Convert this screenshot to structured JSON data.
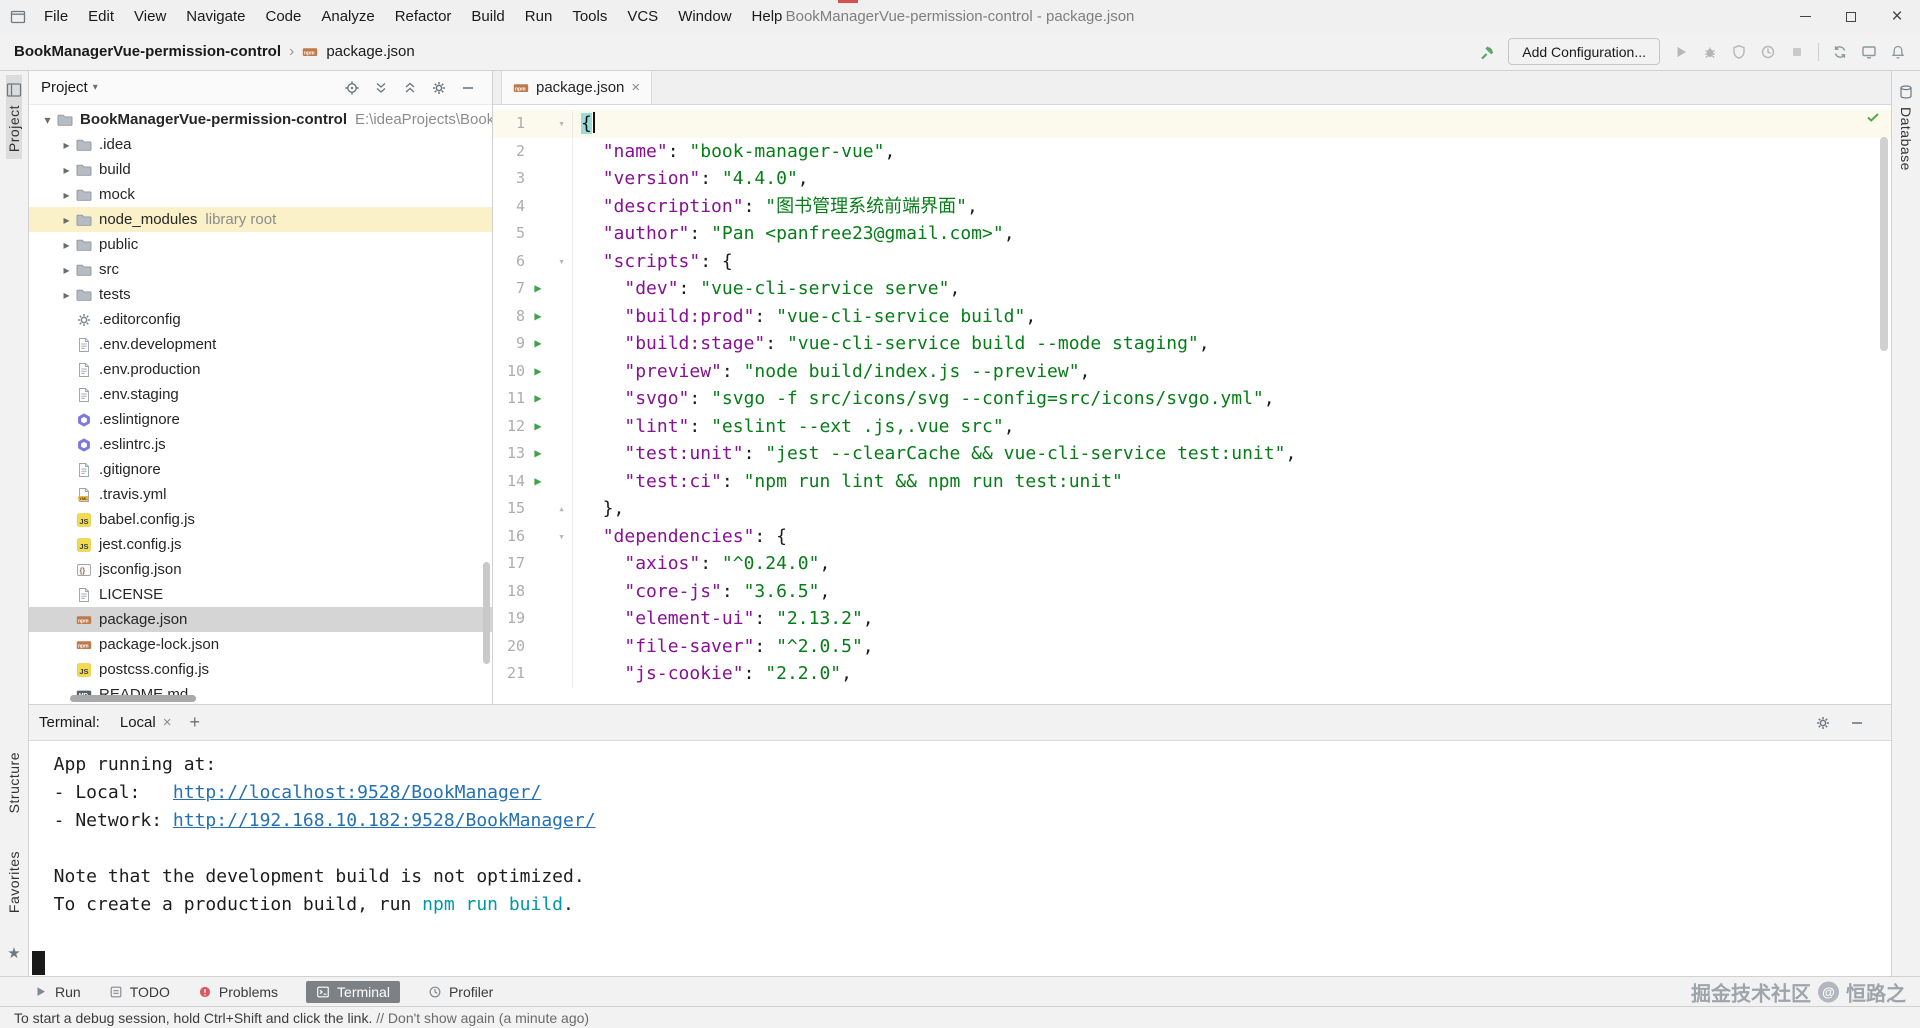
{
  "colors": {
    "accent_green": "#59A869",
    "json_key": "#871094",
    "json_string": "#067D17",
    "link_blue": "#2470B3",
    "terminal_cyan": "#0097A7",
    "problems_red": "#DB5860",
    "selection_gray": "#D5D5D5",
    "library_highlight": "#FAF1C8"
  },
  "window": {
    "title": "BookManagerVue-permission-control - package.json",
    "menu": [
      "File",
      "Edit",
      "View",
      "Navigate",
      "Code",
      "Analyze",
      "Refactor",
      "Build",
      "Run",
      "Tools",
      "VCS",
      "Window",
      "Help"
    ]
  },
  "navbar": {
    "breadcrumb_project": "BookManagerVue-permission-control",
    "breadcrumb_file": "package.json",
    "add_configuration": "Add Configuration...",
    "right_icons": [
      "run-icon",
      "debug-icon",
      "coverage-icon",
      "profiler-icon",
      "stop-icon",
      "divider",
      "sync-icon",
      "monitor-icon",
      "notifications-icon"
    ]
  },
  "stripes": {
    "project": "Project",
    "structure": "Structure",
    "favorites": "Favorites",
    "database": "Database"
  },
  "project_panel": {
    "title": "Project",
    "header_icons": [
      "locate-icon",
      "expand-all-icon",
      "collapse-all-icon",
      "settings-gear-icon",
      "hide-icon"
    ],
    "tree": [
      {
        "label": "BookManagerVue-permission-control",
        "suffix": "E:\\ideaProjects\\BookM",
        "icon": "folder-icon",
        "chevron": "expanded",
        "bold": true,
        "indent": 0
      },
      {
        "label": ".idea",
        "icon": "folder-icon",
        "chevron": "collapsed",
        "indent": 1
      },
      {
        "label": "build",
        "icon": "folder-icon",
        "chevron": "collapsed",
        "indent": 1
      },
      {
        "label": "mock",
        "icon": "folder-icon",
        "chevron": "collapsed",
        "indent": 1
      },
      {
        "label": "node_modules",
        "suffix": "library root",
        "icon": "folder-icon",
        "chevron": "collapsed",
        "indent": 1,
        "highlight": true
      },
      {
        "label": "public",
        "icon": "folder-icon",
        "chevron": "collapsed",
        "indent": 1
      },
      {
        "label": "src",
        "icon": "folder-icon",
        "chevron": "collapsed",
        "indent": 1
      },
      {
        "label": "tests",
        "icon": "folder-icon",
        "chevron": "collapsed",
        "indent": 1
      },
      {
        "label": ".editorconfig",
        "icon": "gear-file-icon",
        "indent": 1
      },
      {
        "label": ".env.development",
        "icon": "text-file-icon",
        "indent": 1
      },
      {
        "label": ".env.production",
        "icon": "text-file-icon",
        "indent": 1
      },
      {
        "label": ".env.staging",
        "icon": "text-file-icon",
        "indent": 1
      },
      {
        "label": ".eslintignore",
        "icon": "eslint-icon",
        "indent": 1
      },
      {
        "label": ".eslintrc.js",
        "icon": "eslint-icon",
        "indent": 1
      },
      {
        "label": ".gitignore",
        "icon": "text-file-icon",
        "indent": 1
      },
      {
        "label": ".travis.yml",
        "icon": "yml-file-icon",
        "indent": 1
      },
      {
        "label": "babel.config.js",
        "icon": "js-icon",
        "indent": 1
      },
      {
        "label": "jest.config.js",
        "icon": "js-icon",
        "indent": 1
      },
      {
        "label": "jsconfig.json",
        "icon": "json-icon",
        "indent": 1
      },
      {
        "label": "LICENSE",
        "icon": "text-file-icon",
        "indent": 1
      },
      {
        "label": "package.json",
        "icon": "npm-file-icon",
        "indent": 1,
        "selected": true
      },
      {
        "label": "package-lock.json",
        "icon": "npm-file-icon",
        "indent": 1
      },
      {
        "label": "postcss.config.js",
        "icon": "js-icon",
        "indent": 1
      },
      {
        "label": "README.md",
        "icon": "md-file-icon",
        "indent": 1
      }
    ]
  },
  "editor": {
    "tab_label": "package.json",
    "lines": [
      {
        "num": 1,
        "fold": "open",
        "caret": true,
        "active": true,
        "tokens": [
          [
            "m",
            "{"
          ]
        ]
      },
      {
        "num": 2,
        "tokens": [
          [
            "p",
            "  "
          ],
          [
            "k",
            "\"name\""
          ],
          [
            "p",
            ": "
          ],
          [
            "s",
            "\"book-manager-vue\""
          ],
          [
            "p",
            ","
          ]
        ]
      },
      {
        "num": 3,
        "tokens": [
          [
            "p",
            "  "
          ],
          [
            "k",
            "\"version\""
          ],
          [
            "p",
            ": "
          ],
          [
            "s",
            "\"4.4.0\""
          ],
          [
            "p",
            ","
          ]
        ]
      },
      {
        "num": 4,
        "tokens": [
          [
            "p",
            "  "
          ],
          [
            "k",
            "\"description\""
          ],
          [
            "p",
            ": "
          ],
          [
            "s",
            "\"图书管理系统前端界面\""
          ],
          [
            "p",
            ","
          ]
        ]
      },
      {
        "num": 5,
        "tokens": [
          [
            "p",
            "  "
          ],
          [
            "k",
            "\"author\""
          ],
          [
            "p",
            ": "
          ],
          [
            "s",
            "\"Pan <panfree23@gmail.com>\""
          ],
          [
            "p",
            ","
          ]
        ]
      },
      {
        "num": 6,
        "fold": "open",
        "tokens": [
          [
            "p",
            "  "
          ],
          [
            "k",
            "\"scripts\""
          ],
          [
            "p",
            ": {"
          ]
        ]
      },
      {
        "num": 7,
        "run": true,
        "tokens": [
          [
            "p",
            "    "
          ],
          [
            "k",
            "\"dev\""
          ],
          [
            "p",
            ": "
          ],
          [
            "s",
            "\"vue-cli-service serve\""
          ],
          [
            "p",
            ","
          ]
        ]
      },
      {
        "num": 8,
        "run": true,
        "tokens": [
          [
            "p",
            "    "
          ],
          [
            "k",
            "\"build:prod\""
          ],
          [
            "p",
            ": "
          ],
          [
            "s",
            "\"vue-cli-service build\""
          ],
          [
            "p",
            ","
          ]
        ]
      },
      {
        "num": 9,
        "run": true,
        "tokens": [
          [
            "p",
            "    "
          ],
          [
            "k",
            "\"build:stage\""
          ],
          [
            "p",
            ": "
          ],
          [
            "s",
            "\"vue-cli-service build --mode staging\""
          ],
          [
            "p",
            ","
          ]
        ]
      },
      {
        "num": 10,
        "run": true,
        "tokens": [
          [
            "p",
            "    "
          ],
          [
            "k",
            "\"preview\""
          ],
          [
            "p",
            ": "
          ],
          [
            "s",
            "\"node build/index.js --preview\""
          ],
          [
            "p",
            ","
          ]
        ]
      },
      {
        "num": 11,
        "run": true,
        "tokens": [
          [
            "p",
            "    "
          ],
          [
            "k",
            "\"svgo\""
          ],
          [
            "p",
            ": "
          ],
          [
            "s",
            "\"svgo -f src/icons/svg --config=src/icons/svgo.yml\""
          ],
          [
            "p",
            ","
          ]
        ]
      },
      {
        "num": 12,
        "run": true,
        "tokens": [
          [
            "p",
            "    "
          ],
          [
            "k",
            "\"lint\""
          ],
          [
            "p",
            ": "
          ],
          [
            "s",
            "\"eslint --ext .js,.vue src\""
          ],
          [
            "p",
            ","
          ]
        ]
      },
      {
        "num": 13,
        "run": true,
        "tokens": [
          [
            "p",
            "    "
          ],
          [
            "k",
            "\"test:unit\""
          ],
          [
            "p",
            ": "
          ],
          [
            "s",
            "\"jest --clearCache && vue-cli-service test:unit\""
          ],
          [
            "p",
            ","
          ]
        ]
      },
      {
        "num": 14,
        "run": true,
        "tokens": [
          [
            "p",
            "    "
          ],
          [
            "k",
            "\"test:ci\""
          ],
          [
            "p",
            ": "
          ],
          [
            "s",
            "\"npm run lint && npm run test:unit\""
          ]
        ]
      },
      {
        "num": 15,
        "fold": "end",
        "tokens": [
          [
            "p",
            "  },"
          ]
        ]
      },
      {
        "num": 16,
        "fold": "open",
        "tokens": [
          [
            "p",
            "  "
          ],
          [
            "k",
            "\"dependencies\""
          ],
          [
            "p",
            ": {"
          ]
        ]
      },
      {
        "num": 17,
        "tokens": [
          [
            "p",
            "    "
          ],
          [
            "k",
            "\"axios\""
          ],
          [
            "p",
            ": "
          ],
          [
            "s",
            "\"^0.24.0\""
          ],
          [
            "p",
            ","
          ]
        ]
      },
      {
        "num": 18,
        "tokens": [
          [
            "p",
            "    "
          ],
          [
            "k",
            "\"core-js\""
          ],
          [
            "p",
            ": "
          ],
          [
            "s",
            "\"3.6.5\""
          ],
          [
            "p",
            ","
          ]
        ]
      },
      {
        "num": 19,
        "tokens": [
          [
            "p",
            "    "
          ],
          [
            "k",
            "\"element-ui\""
          ],
          [
            "p",
            ": "
          ],
          [
            "s",
            "\"2.13.2\""
          ],
          [
            "p",
            ","
          ]
        ]
      },
      {
        "num": 20,
        "tokens": [
          [
            "p",
            "    "
          ],
          [
            "k",
            "\"file-saver\""
          ],
          [
            "p",
            ": "
          ],
          [
            "s",
            "\"^2.0.5\""
          ],
          [
            "p",
            ","
          ]
        ]
      },
      {
        "num": 21,
        "tokens": [
          [
            "p",
            "    "
          ],
          [
            "k",
            "\"js-cookie\""
          ],
          [
            "p",
            ": "
          ],
          [
            "s",
            "\"2.2.0\""
          ],
          [
            "p",
            ","
          ]
        ]
      }
    ]
  },
  "terminal": {
    "label": "Terminal:",
    "tab": "Local",
    "lines": [
      {
        "parts": [
          [
            "t",
            "  App running at:"
          ]
        ]
      },
      {
        "parts": [
          [
            "t",
            "  - Local:   "
          ],
          [
            "link",
            "http://localhost:9528/BookManager/"
          ]
        ]
      },
      {
        "parts": [
          [
            "t",
            "  - Network: "
          ],
          [
            "link",
            "http://192.168.10.182:9528/BookManager/"
          ]
        ]
      },
      {
        "parts": []
      },
      {
        "parts": [
          [
            "t",
            "  Note that the development build is not optimized."
          ]
        ]
      },
      {
        "parts": [
          [
            "t",
            "  To create a production build, run "
          ],
          [
            "cmd",
            "npm run build"
          ],
          [
            "t",
            "."
          ]
        ]
      },
      {
        "parts": []
      },
      {
        "parts": [
          [
            "cursor",
            ""
          ]
        ]
      }
    ]
  },
  "bottom_bar": {
    "tabs": [
      {
        "label": "Run",
        "icon": "run-tab-icon"
      },
      {
        "label": "TODO",
        "icon": "todo-tab-icon"
      },
      {
        "label": "Problems",
        "icon": "problems-tab-icon"
      },
      {
        "label": "Terminal",
        "icon": "terminal-tab-icon",
        "active": true
      },
      {
        "label": "Profiler",
        "icon": "profiler-tab-icon"
      }
    ]
  },
  "watermark": {
    "site": "掘金技术社区",
    "author": "恒路之"
  },
  "status_bar": {
    "message": "To start a debug session, hold Ctrl+Shift and click the link. ",
    "separator": "// ",
    "action": "Don't show again",
    "time": " (a minute ago)"
  }
}
